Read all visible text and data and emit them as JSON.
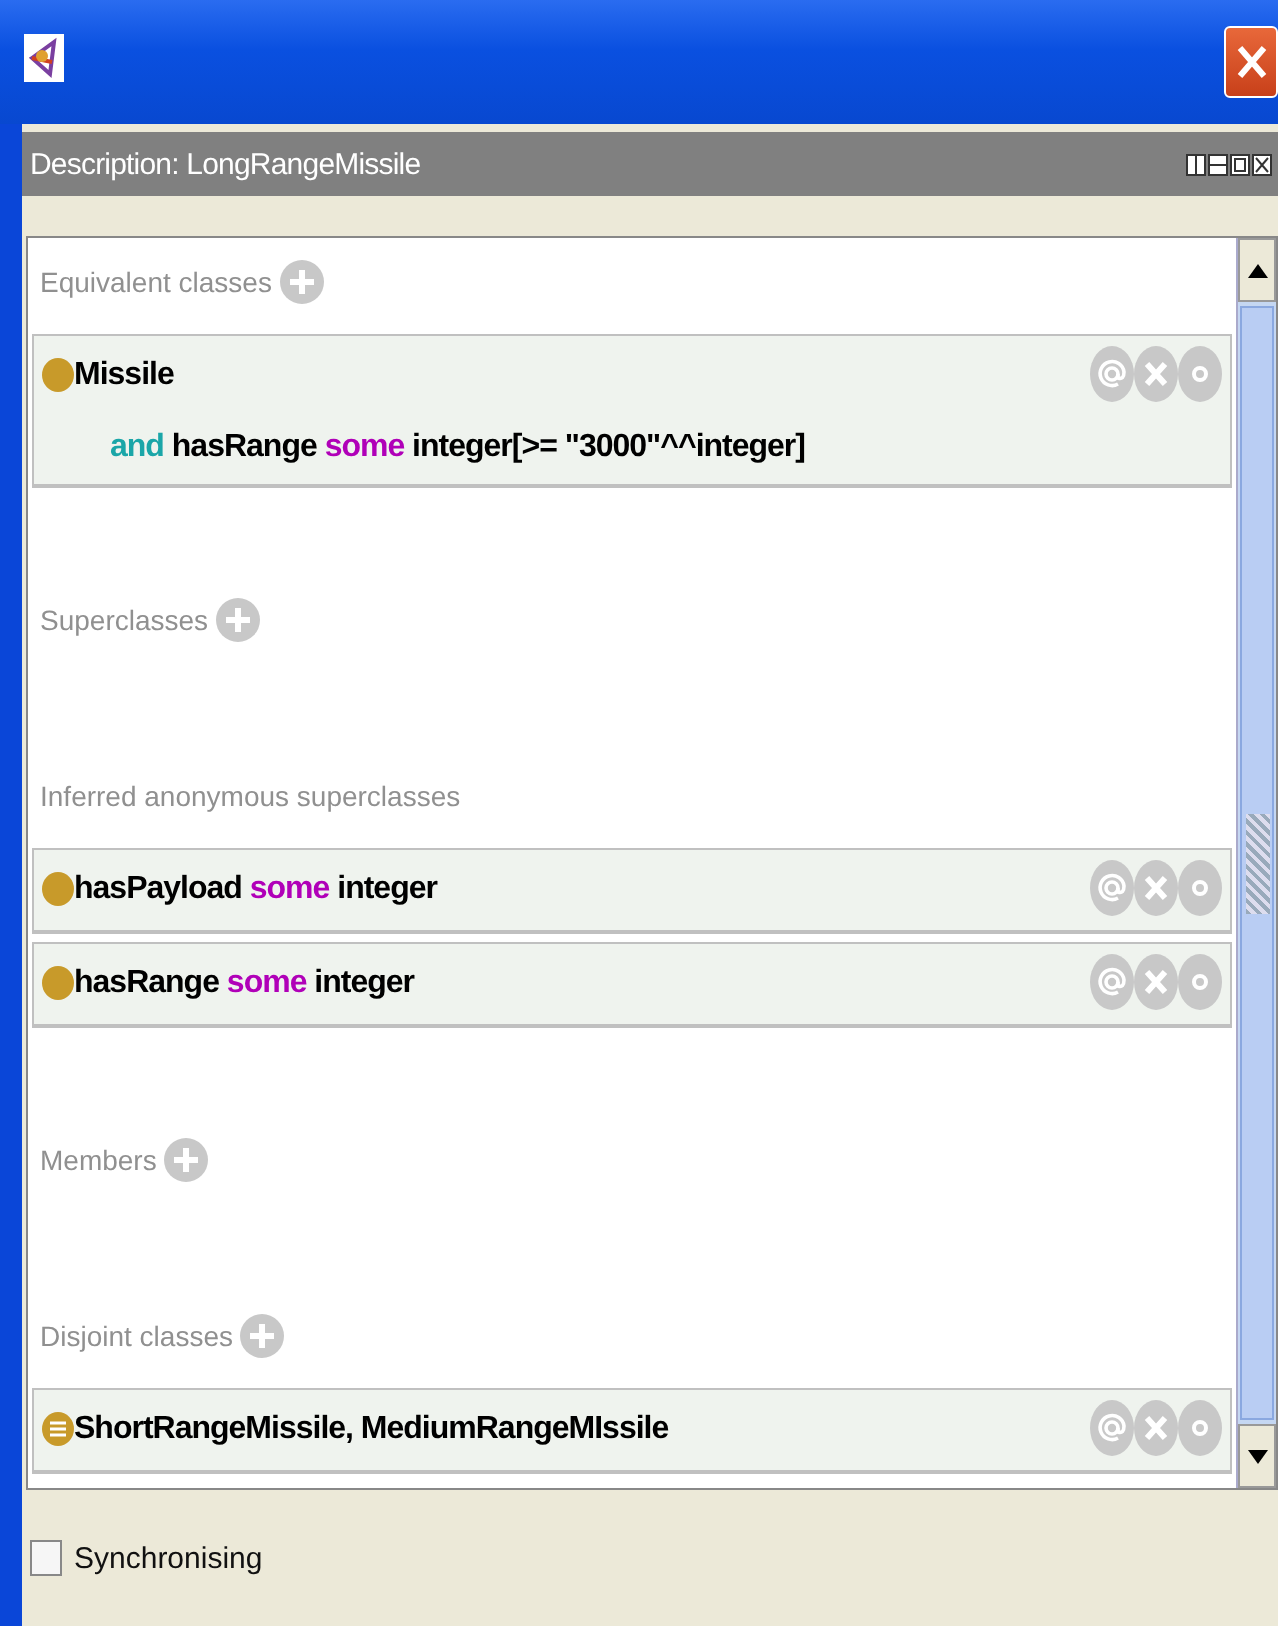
{
  "panel": {
    "title": "Description: LongRangeMissile"
  },
  "sections": [
    {
      "title": "Equivalent classes",
      "rows": [
        {
          "kind": "class",
          "lines": [
            [
              {
                "text": "Missile",
                "kind": "name"
              }
            ],
            [
              {
                "text": "and",
                "kind": "keyword"
              },
              {
                "text": " hasRange ",
                "kind": "name"
              },
              {
                "text": "some",
                "kind": "quantifier"
              },
              {
                "text": " integer[>= \"3000\"^^integer]",
                "kind": "name"
              }
            ]
          ]
        }
      ]
    },
    {
      "title": "Superclasses"
    },
    {
      "title": "Inferred anonymous superclasses",
      "add": false,
      "rows": [
        {
          "kind": "class",
          "lines": [
            [
              {
                "text": "hasPayload ",
                "kind": "name"
              },
              {
                "text": "some",
                "kind": "quantifier"
              },
              {
                "text": " integer",
                "kind": "name"
              }
            ]
          ]
        },
        {
          "kind": "class",
          "lines": [
            [
              {
                "text": "hasRange ",
                "kind": "name"
              },
              {
                "text": "some",
                "kind": "quantifier"
              },
              {
                "text": " integer",
                "kind": "name"
              }
            ]
          ]
        }
      ]
    },
    {
      "title": "Members"
    },
    {
      "title": "Disjoint classes",
      "rows": [
        {
          "kind": "disjoint",
          "lines": [
            [
              {
                "text": "ShortRangeMissile, MediumRangeMIssile",
                "kind": "name"
              }
            ]
          ]
        }
      ]
    }
  ],
  "footer": {
    "label": "Synchronising",
    "checked": false
  }
}
